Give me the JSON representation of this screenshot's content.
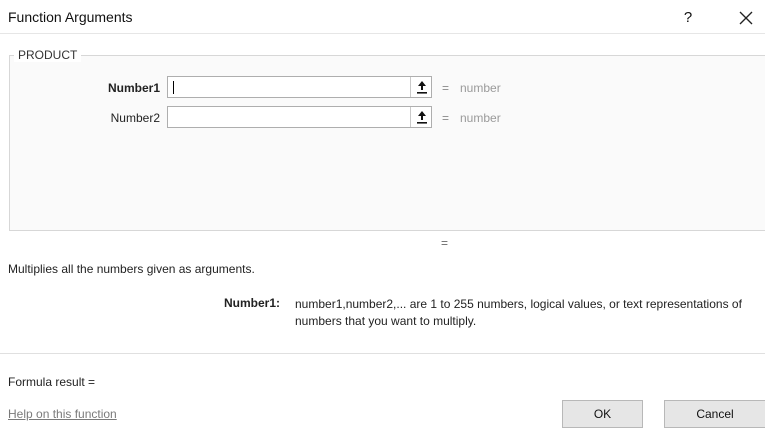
{
  "dialog": {
    "title": "Function Arguments",
    "help_glyph": "?",
    "close_icon": "close-icon"
  },
  "function_name": "PRODUCT",
  "arguments": [
    {
      "label": "Number1",
      "value": "",
      "equals": "=",
      "result": "number",
      "bold": true
    },
    {
      "label": "Number2",
      "value": "",
      "equals": "=",
      "result": "number",
      "bold": false
    }
  ],
  "result_equals": "=",
  "description": "Multiplies all the numbers given as arguments.",
  "arg_help": {
    "name": "Number1:",
    "text": "number1,number2,... are 1 to 255 numbers, logical values, or text representations of numbers that you want to multiply."
  },
  "formula_result_label": "Formula result =",
  "help_link": "Help on this function",
  "buttons": {
    "ok": "OK",
    "cancel": "Cancel"
  }
}
